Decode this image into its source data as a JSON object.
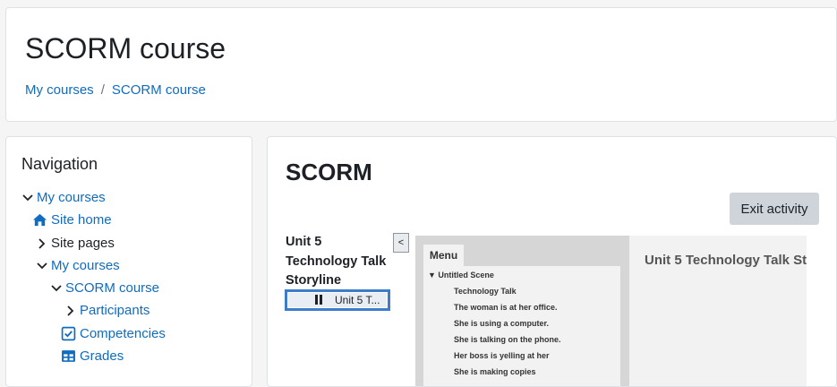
{
  "header": {
    "title": "SCORM course",
    "breadcrumb": [
      {
        "label": "My courses"
      },
      {
        "label": "SCORM course"
      }
    ],
    "breadcrumb_separator": "/"
  },
  "navigation": {
    "title": "Navigation",
    "items": [
      {
        "label": "My courses",
        "icon": "chevron-down-icon"
      },
      {
        "label": "Site home",
        "icon": "home-icon"
      },
      {
        "label": "Site pages",
        "icon": "chevron-right-icon"
      },
      {
        "label": "My courses",
        "icon": "chevron-down-icon"
      },
      {
        "label": "SCORM course",
        "icon": "chevron-down-icon"
      },
      {
        "label": "Participants",
        "icon": "chevron-right-icon"
      },
      {
        "label": "Competencies",
        "icon": "checkbox-icon"
      },
      {
        "label": "Grades",
        "icon": "table-icon"
      }
    ]
  },
  "main": {
    "title": "SCORM",
    "exit_label": "Exit activity",
    "toc": {
      "title": "Unit 5 Technology Talk Storyline",
      "collapse_label": "<",
      "sco_label": "Unit 5 T..."
    },
    "player": {
      "heading": "Unit 5 Technology Talk St",
      "menu_tab": "Menu",
      "scene_label": "▼  Untitled Scene",
      "scene_items": [
        "Technology Talk",
        "The woman is at her office.",
        "She is using a computer.",
        "She is talking on the phone.",
        "Her boss is yelling at her",
        "She is making copies"
      ]
    }
  },
  "colors": {
    "link": "#0f6cbf",
    "button_bg": "#ced4da",
    "selected_border": "#3d7cc9"
  }
}
